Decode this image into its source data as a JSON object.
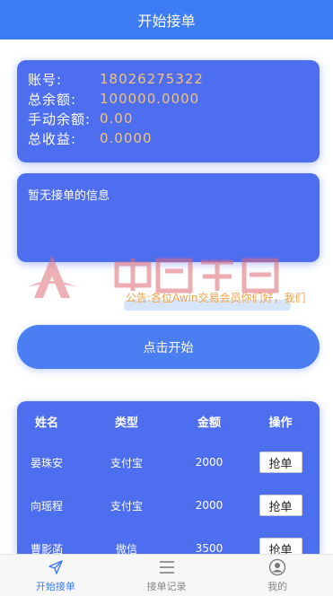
{
  "header": {
    "title": "开始接单"
  },
  "account": {
    "rows": [
      {
        "label": "账号:",
        "value": "18026275322"
      },
      {
        "label": "总余额:",
        "value": "100000.0000"
      },
      {
        "label": "手动余额:",
        "value": "0.00"
      },
      {
        "label": "总收益:",
        "value": "0.0000"
      }
    ]
  },
  "message": {
    "text": "暂无接单的信息"
  },
  "notice": {
    "text": "公告:各位Awin交易会员你们好，我们"
  },
  "start_button": {
    "label": "点击开始"
  },
  "orders": {
    "headers": [
      "姓名",
      "类型",
      "金额",
      "操作"
    ],
    "rows": [
      {
        "name": "晏珠安",
        "type": "支付宝",
        "amount": "2000",
        "action": "抢单"
      },
      {
        "name": "向瑶程",
        "type": "支付宝",
        "amount": "2000",
        "action": "抢单"
      },
      {
        "name": "曹影菡",
        "type": "微信",
        "amount": "3500",
        "action": "抢单"
      }
    ]
  },
  "tabbar": {
    "items": [
      {
        "label": "开始接单",
        "icon": "send-icon",
        "active": true
      },
      {
        "label": "接单记录",
        "icon": "list-icon",
        "active": false
      },
      {
        "label": "我的",
        "icon": "user-icon",
        "active": false
      }
    ]
  },
  "colors": {
    "header": "#3d7cf2",
    "card": "#4e6ef0",
    "value": "#f4c27a",
    "notice": "#f2a24a",
    "tab_active": "#3d7cf2"
  }
}
